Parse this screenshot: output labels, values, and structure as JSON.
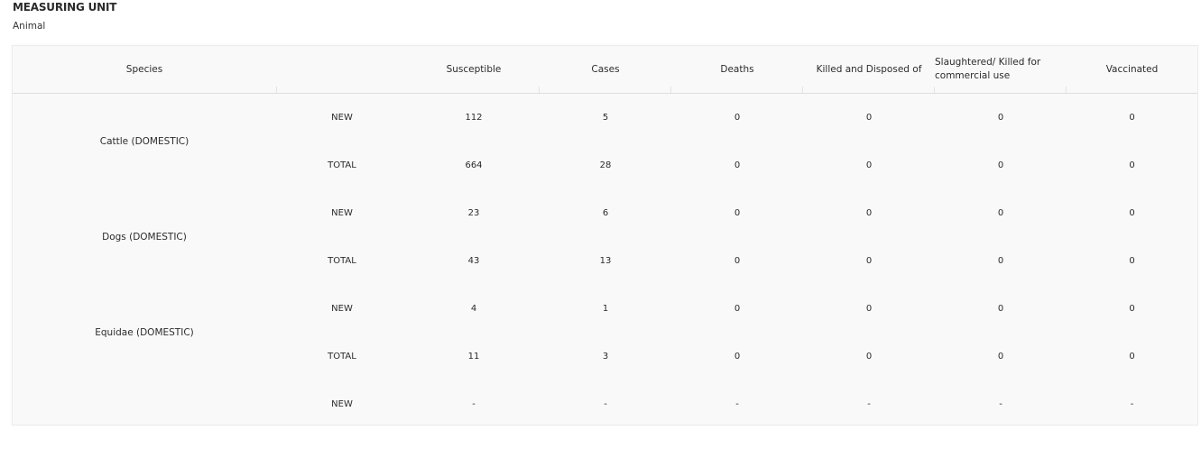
{
  "measuring_unit": {
    "title": "MEASURING UNIT",
    "value": "Animal"
  },
  "table": {
    "headers": {
      "species": "Species",
      "susceptible": "Susceptible",
      "cases": "Cases",
      "deaths": "Deaths",
      "killed_disposed": "Killed and Disposed of",
      "slaughtered": "Slaughtered/ Killed for commercial use",
      "vaccinated": "Vaccinated"
    },
    "groups": [
      {
        "species": "Cattle (DOMESTIC)",
        "rows": [
          {
            "label": "NEW",
            "susceptible": "112",
            "cases": "5",
            "deaths": "0",
            "killed_disposed": "0",
            "slaughtered": "0",
            "vaccinated": "0"
          },
          {
            "label": "TOTAL",
            "susceptible": "664",
            "cases": "28",
            "deaths": "0",
            "killed_disposed": "0",
            "slaughtered": "0",
            "vaccinated": "0"
          }
        ]
      },
      {
        "species": "Dogs (DOMESTIC)",
        "rows": [
          {
            "label": "NEW",
            "susceptible": "23",
            "cases": "6",
            "deaths": "0",
            "killed_disposed": "0",
            "slaughtered": "0",
            "vaccinated": "0"
          },
          {
            "label": "TOTAL",
            "susceptible": "43",
            "cases": "13",
            "deaths": "0",
            "killed_disposed": "0",
            "slaughtered": "0",
            "vaccinated": "0"
          }
        ]
      },
      {
        "species": "Equidae (DOMESTIC)",
        "rows": [
          {
            "label": "NEW",
            "susceptible": "4",
            "cases": "1",
            "deaths": "0",
            "killed_disposed": "0",
            "slaughtered": "0",
            "vaccinated": "0"
          },
          {
            "label": "TOTAL",
            "susceptible": "11",
            "cases": "3",
            "deaths": "0",
            "killed_disposed": "0",
            "slaughtered": "0",
            "vaccinated": "0"
          }
        ]
      },
      {
        "species": "",
        "rows": [
          {
            "label": "NEW",
            "susceptible": "-",
            "cases": "-",
            "deaths": "-",
            "killed_disposed": "-",
            "slaughtered": "-",
            "vaccinated": "-"
          }
        ]
      }
    ]
  }
}
